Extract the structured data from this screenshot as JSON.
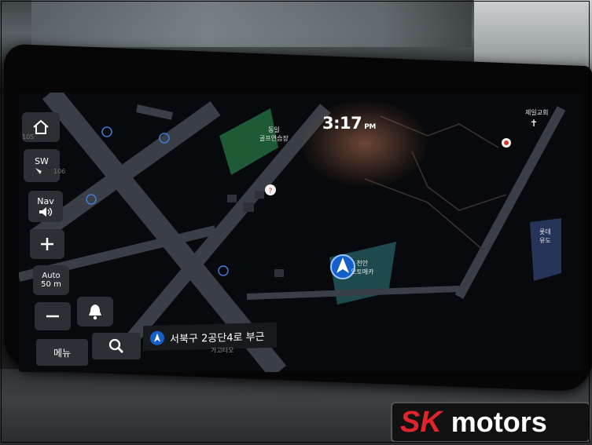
{
  "status": {
    "time": "3:17",
    "ampm": "PM"
  },
  "controls": {
    "compass_label": "SW",
    "nav_label": "Nav",
    "zoom_mode": "Auto",
    "zoom_scale": "50 m",
    "zoom_in": "+",
    "zoom_out": "−",
    "route_number_left": "105",
    "route_number_right": "106"
  },
  "bottom_bar": {
    "menu_label": "메뉴",
    "current_street": "서북구 2공단4로 부근",
    "street_sub": "가고타오"
  },
  "map_labels": {
    "golf_range": "동일\n골프연습장",
    "dealer": "천안\n오토메카",
    "church": "제일교회",
    "right_poi": "롯데\n유도"
  },
  "watermark": {
    "brand_red": "SK",
    "brand_white": "motors",
    "red_color": "#e0242c"
  },
  "icons": [
    "home-icon",
    "compass-icon",
    "speaker-icon",
    "plus-icon",
    "minus-icon",
    "bell-icon",
    "search-icon",
    "navigation-arrow-icon",
    "cross-icon"
  ]
}
